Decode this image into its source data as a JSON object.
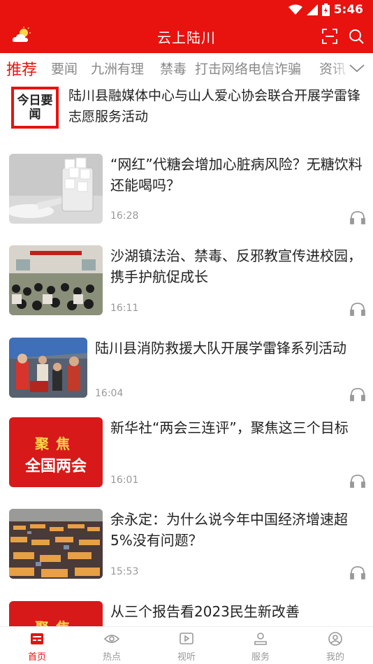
{
  "status_bar": {
    "time": "5:46"
  },
  "app": {
    "title": "云上陆川"
  },
  "tabs": [
    {
      "label": "推荐",
      "active": true
    },
    {
      "label": "要闻"
    },
    {
      "label": "九洲有理"
    },
    {
      "label": "禁毒"
    },
    {
      "label": "打击网络电信诈骗"
    },
    {
      "label": "资讯"
    }
  ],
  "lead": {
    "logo_text": "今日要闻",
    "headline": "陆川县融媒体中心与山人爱心协会联合开展学雷锋志愿服务活动"
  },
  "articles": [
    {
      "headline": "“网红”代糖会增加心脏病风险？无糖饮料还能喝吗？",
      "time": "16:28"
    },
    {
      "headline": "沙湖镇法治、禁毒、反邪教宣传进校园，携手护航促成长",
      "time": "16:11"
    },
    {
      "headline": "陆川县消防救援大队开展学雷锋系列活动",
      "time": "16:04"
    },
    {
      "headline": "新华社“两会三连评”，聚焦这三个目标",
      "time": "16:01",
      "thumb_line1": "聚焦",
      "thumb_line2": "全国两会"
    },
    {
      "headline": "余永定：为什么说今年中国经济增速超5%没有问题？",
      "time": "15:53"
    },
    {
      "headline": "从三个报告看2023民生新改善",
      "thumb_line1": "聚焦"
    }
  ],
  "bottom_nav": [
    {
      "label": "首页",
      "icon": "home-icon",
      "active": true
    },
    {
      "label": "热点",
      "icon": "eye-icon"
    },
    {
      "label": "视听",
      "icon": "play-icon"
    },
    {
      "label": "服务",
      "icon": "service-icon"
    },
    {
      "label": "我的",
      "icon": "profile-icon"
    }
  ],
  "colors": {
    "brand": "#e8120f",
    "muted": "#999999",
    "text": "#222222"
  }
}
